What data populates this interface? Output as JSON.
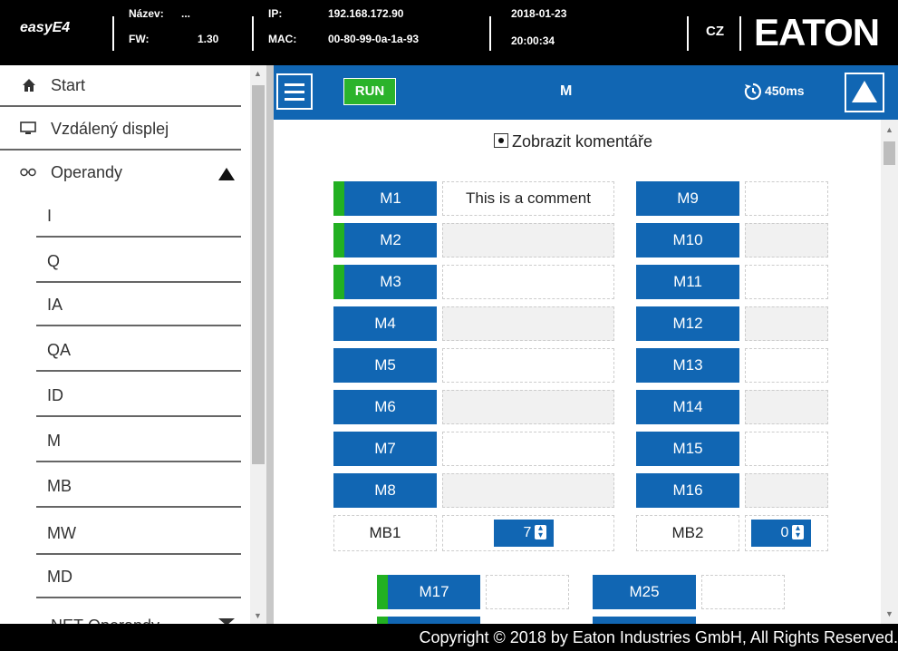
{
  "header": {
    "app_name": "easyE4",
    "name_label": "Název:",
    "name_value": "...",
    "fw_label": "FW:",
    "fw_value": "1.30",
    "ip_label": "IP:",
    "ip_value": "192.168.172.90",
    "mac_label": "MAC:",
    "mac_value": "00-80-99-0a-1a-93",
    "date": "2018-01-23",
    "time": "20:00:34",
    "language": "CZ",
    "logo": "EATON"
  },
  "sidebar": {
    "start": "Start",
    "remote_display": "Vzdálený displej",
    "operands": "Operandy",
    "sub_items": [
      "I",
      "Q",
      "IA",
      "QA",
      "ID",
      "M",
      "MB",
      "MW",
      "MD"
    ],
    "cut_item": "NET-Operandy"
  },
  "toolbar": {
    "run": "RUN",
    "title": "M",
    "refresh": "450ms",
    "accent": "#1166b3",
    "run_color": "#2bb32b"
  },
  "content": {
    "show_comments": "Zobrazit komentáře",
    "left_markers": [
      {
        "label": "M1",
        "active": true,
        "comment": "This is a comment"
      },
      {
        "label": "M2",
        "active": true,
        "comment": ""
      },
      {
        "label": "M3",
        "active": true,
        "comment": ""
      },
      {
        "label": "M4",
        "active": false,
        "comment": ""
      },
      {
        "label": "M5",
        "active": false,
        "comment": ""
      },
      {
        "label": "M6",
        "active": false,
        "comment": ""
      },
      {
        "label": "M7",
        "active": false,
        "comment": ""
      },
      {
        "label": "M8",
        "active": false,
        "comment": ""
      }
    ],
    "right_markers": [
      {
        "label": "M9",
        "active": false,
        "comment": ""
      },
      {
        "label": "M10",
        "active": false,
        "comment": ""
      },
      {
        "label": "M11",
        "active": false,
        "comment": ""
      },
      {
        "label": "M12",
        "active": false,
        "comment": ""
      },
      {
        "label": "M13",
        "active": false,
        "comment": ""
      },
      {
        "label": "M14",
        "active": false,
        "comment": ""
      },
      {
        "label": "M15",
        "active": false,
        "comment": ""
      },
      {
        "label": "M16",
        "active": false,
        "comment": ""
      }
    ],
    "mb1_label": "MB1",
    "mb1_value": "7",
    "mb2_label": "MB2",
    "mb2_value": "0",
    "m17": "M17",
    "m25": "M25",
    "m17_active": true
  },
  "footer": {
    "copyright": "Copyright © 2018 by Eaton Industries GmbH, All Rights Reserved."
  }
}
